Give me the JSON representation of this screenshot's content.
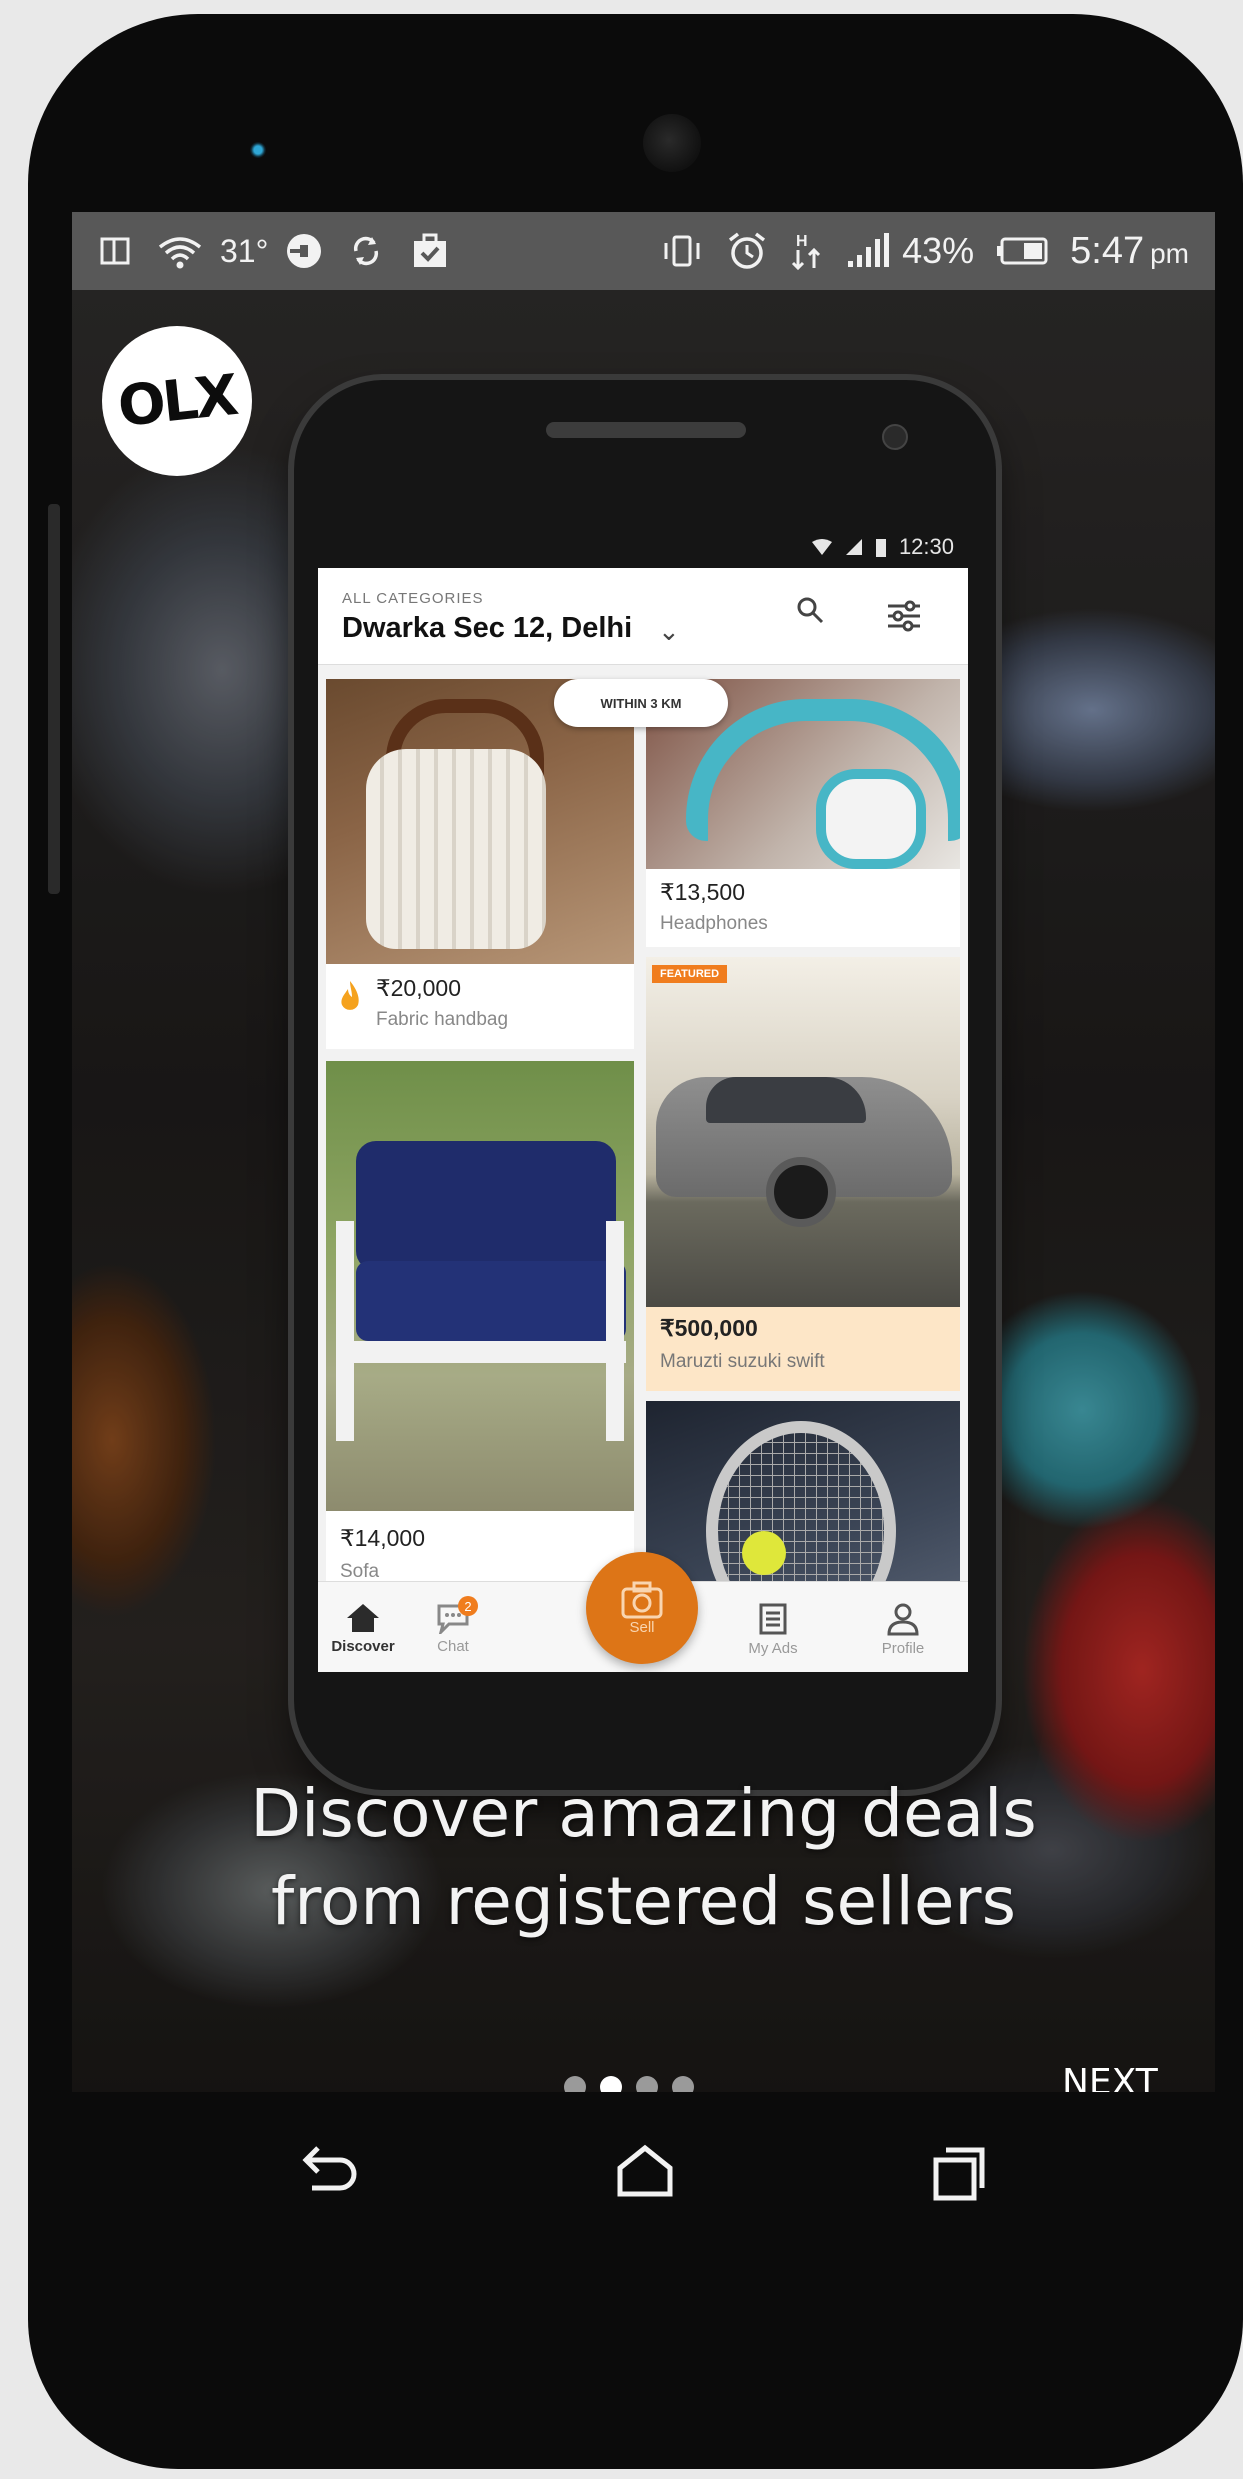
{
  "status_bar": {
    "temperature": "31°",
    "battery_percent": "43%",
    "time": "5:47",
    "time_suffix": "pm"
  },
  "brand": {
    "logo_text": "OLX"
  },
  "mock_phone": {
    "status_time": "12:30",
    "header": {
      "category_label": "ALL CATEGORIES",
      "location": "Dwarka Sec 12, Delhi"
    },
    "nearby_badge": "WITHIN 3 KM",
    "featured_badge": "FEATURED",
    "listings": [
      {
        "price": "₹20,000",
        "title": "Fabric handbag"
      },
      {
        "price": "₹13,500",
        "title": "Headphones"
      },
      {
        "price": "₹500,000",
        "title": "Maruzti suzuki swift"
      },
      {
        "price": "₹14,000",
        "title": "Sofa"
      }
    ],
    "bottom_nav": {
      "discover": "Discover",
      "chat": "Chat",
      "chat_badge": "2",
      "sell": "Sell",
      "my_ads": "My Ads",
      "profile": "Profile"
    }
  },
  "onboarding": {
    "headline_line1": "Discover amazing deals",
    "headline_line2": "from registered sellers",
    "page_total": 4,
    "page_active": 2,
    "next_label": "NEXT"
  },
  "colors": {
    "accent_orange": "#dd7517",
    "status_bar": "#585858"
  }
}
